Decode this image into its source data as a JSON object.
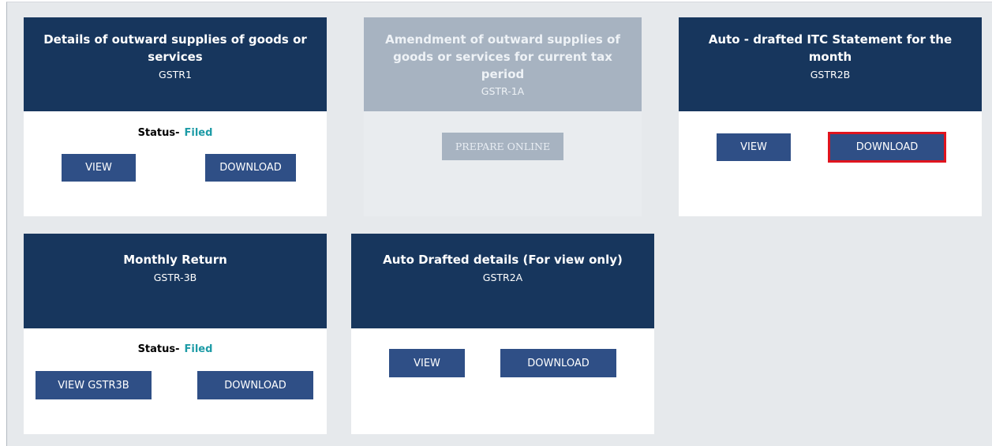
{
  "tiles": [
    {
      "title": "Details of outward supplies of goods or services",
      "code": "GSTR1",
      "status_label": "Status-",
      "status_value": "Filed",
      "buttons": [
        "VIEW",
        "DOWNLOAD"
      ]
    },
    {
      "title": "Amendment of outward supplies of goods or services for current tax period",
      "code": "GSTR-1A",
      "buttons": [
        "PREPARE ONLINE"
      ],
      "disabled": true
    },
    {
      "title": "Auto - drafted ITC Statement for the month",
      "code": "GSTR2B",
      "buttons": [
        "VIEW",
        "DOWNLOAD"
      ],
      "highlighted_button": "DOWNLOAD"
    },
    {
      "title": "Monthly Return",
      "code": "GSTR-3B",
      "status_label": "Status-",
      "status_value": "Filed",
      "buttons": [
        "VIEW GSTR3B",
        "DOWNLOAD"
      ]
    },
    {
      "title": "Auto Drafted details (For view only)",
      "code": "GSTR2A",
      "buttons": [
        "VIEW",
        "DOWNLOAD"
      ]
    }
  ],
  "colors": {
    "header": "#17365d",
    "button": "#2f4f86",
    "status_filed": "#1d9ba6",
    "disabled": "#a7b3c1",
    "highlight": "#e0141e",
    "background": "#e6e9ec"
  }
}
